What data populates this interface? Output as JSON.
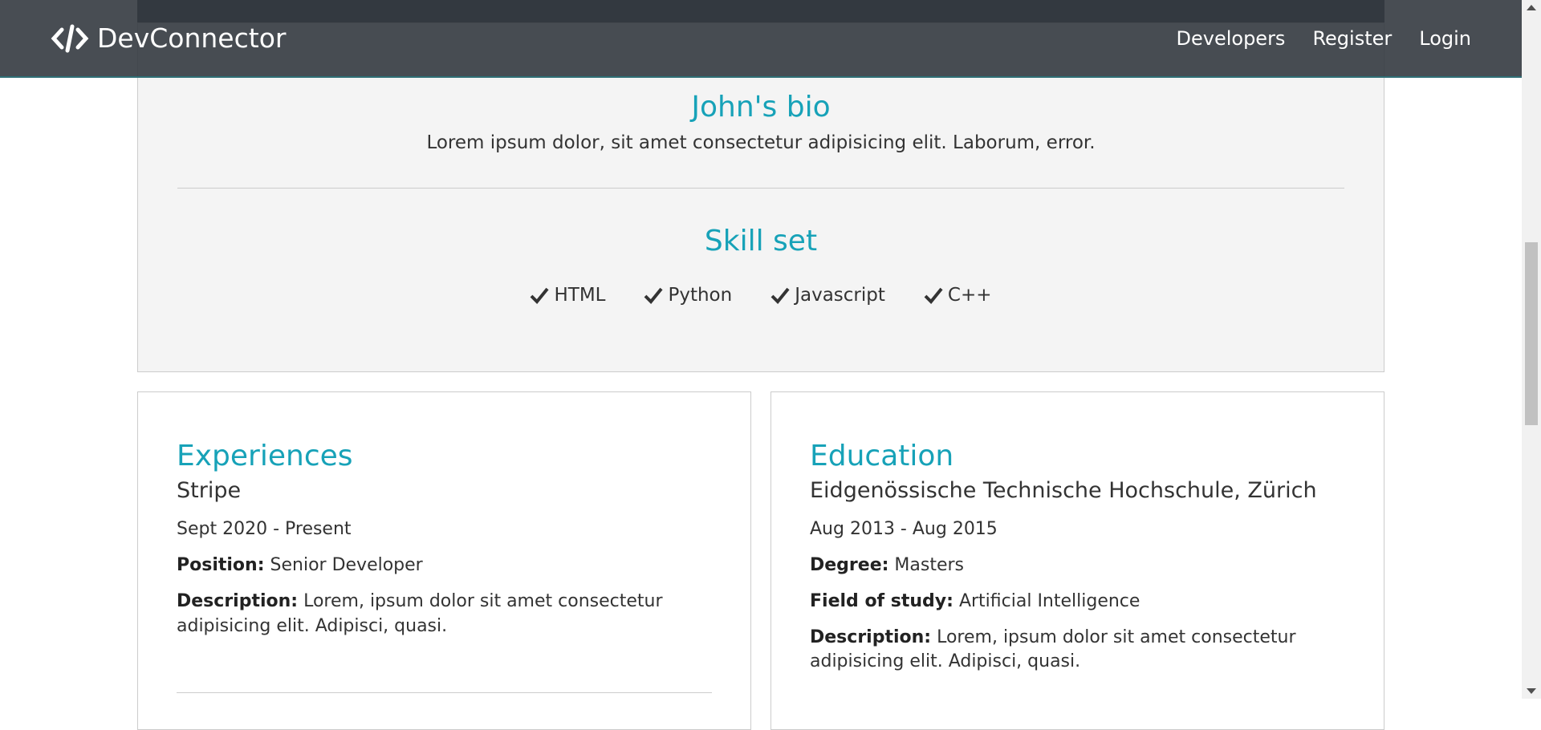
{
  "navbar": {
    "brand": "DevConnector",
    "brand_icon": "code-icon",
    "links": [
      "Developers",
      "Register",
      "Login"
    ]
  },
  "bio": {
    "title": "John's bio",
    "text": "Lorem ipsum dolor, sit amet consectetur adipisicing elit. Laborum, error."
  },
  "skills": {
    "title": "Skill set",
    "icon": "check-icon",
    "items": [
      "HTML",
      "Python",
      "Javascript",
      "C++"
    ]
  },
  "experiences": {
    "title": "Experiences",
    "company": "Stripe",
    "dates": "Sept 2020 - Present",
    "position_label": "Position:",
    "position": "Senior Developer",
    "description_label": "Description:",
    "description": "Lorem, ipsum dolor sit amet consectetur adipisicing elit. Adipisci, quasi."
  },
  "education": {
    "title": "Education",
    "school": "Eidgenössische Technische Hochschule, Zürich",
    "dates": "Aug 2013 - Aug 2015",
    "degree_label": "Degree:",
    "degree": "Masters",
    "field_label": "Field of study:",
    "field": "Artificial Intelligence",
    "description_label": "Description:",
    "description": "Lorem, ipsum dolor sit amet consectetur adipisicing elit. Adipisci, quasi."
  },
  "colors": {
    "accent": "#17a2b8",
    "navbar": "#343a40",
    "card_bg": "#f4f4f4"
  }
}
